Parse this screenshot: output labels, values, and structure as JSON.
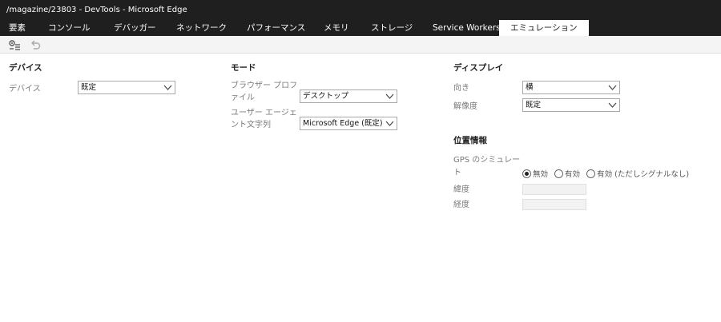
{
  "window": {
    "title": "/magazine/23803 - DevTools - Microsoft Edge"
  },
  "tabs": [
    {
      "label": "要素"
    },
    {
      "label": "コンソール"
    },
    {
      "label": "デバッガー"
    },
    {
      "label": "ネットワーク"
    },
    {
      "label": "パフォーマンス"
    },
    {
      "label": "メモリ"
    },
    {
      "label": "ストレージ"
    },
    {
      "label": "Service Workers"
    },
    {
      "label": "エミュレーション"
    }
  ],
  "active_tab": "エミュレーション",
  "toolbar": {
    "icons": [
      "settings-list-icon",
      "undo-icon"
    ]
  },
  "device": {
    "title": "デバイス",
    "device_label": "デバイス",
    "device_value": "既定"
  },
  "mode": {
    "title": "モード",
    "browser_profile_label_1": "ブラウザー プロフ",
    "browser_profile_label_2": "ァイル",
    "browser_profile_value": "デスクトップ",
    "user_agent_label_1": "ユーザー エージェ",
    "user_agent_label_2": "ント文字列",
    "user_agent_value": "Microsoft Edge (既定)"
  },
  "display": {
    "title": "ディスプレイ",
    "orientation_label": "向き",
    "orientation_value": "横",
    "resolution_label": "解像度",
    "resolution_value": "既定"
  },
  "geolocation": {
    "title": "位置情報",
    "gps_label_1": "GPS のシミュレー",
    "gps_label_2": "ト",
    "options": [
      "無効",
      "有効",
      "有効 (ただしシグナルなし)"
    ],
    "selected": "無効",
    "latitude_label": "緯度",
    "latitude_value": "",
    "longitude_label": "経度",
    "longitude_value": ""
  },
  "colors": {
    "chrome_bg": "#1f1f1f",
    "active_tab_bg": "#ffffff",
    "toolbar_bg": "#f4f4f4"
  }
}
